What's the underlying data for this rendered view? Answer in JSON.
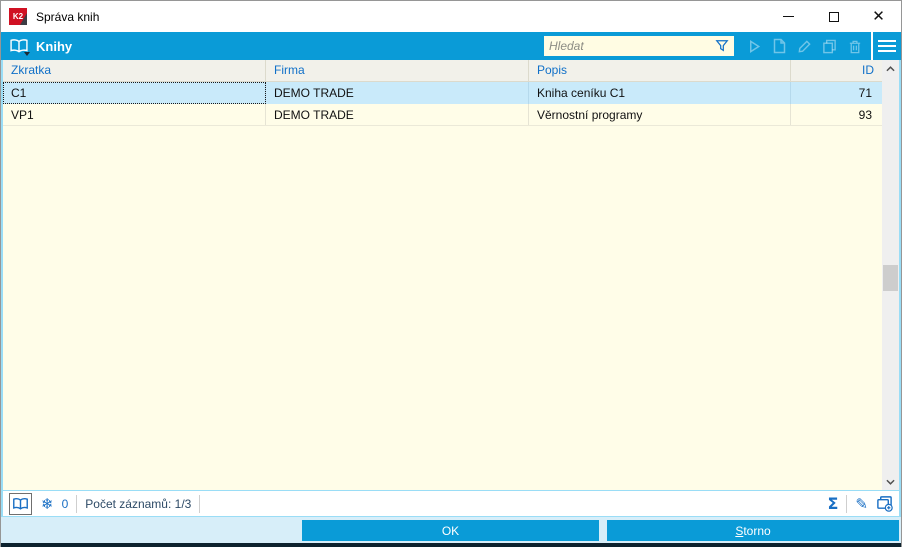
{
  "titlebar": {
    "title": "Správa knih",
    "logo_text": "K2"
  },
  "appbar": {
    "title": "Knihy",
    "search": {
      "placeholder": "Hledat"
    }
  },
  "table": {
    "columns": [
      "Zkratka",
      "Firma",
      "Popis",
      "ID"
    ],
    "rows": [
      {
        "zkratka": "C1",
        "firma": "DEMO TRADE",
        "popis": "Kniha ceníku C1",
        "id": "71",
        "selected": true
      },
      {
        "zkratka": "VP1",
        "firma": "DEMO TRADE",
        "popis": "Věrnostní programy",
        "id": "93",
        "selected": false
      }
    ]
  },
  "statusbar": {
    "frozen_count": "0",
    "record_count_label": "Počet záznamů: 1/3"
  },
  "footer": {
    "ok_label": "OK",
    "storno_label": "Storno"
  },
  "colors": {
    "accent_blue": "#0a9bd7",
    "selected_row": "#c9eafa",
    "table_background": "#fffde8",
    "footer_background": "#d7eef9",
    "header_text_blue": "#1070c8",
    "logo_red": "#d01123",
    "dark_strip": "#0d222e"
  }
}
